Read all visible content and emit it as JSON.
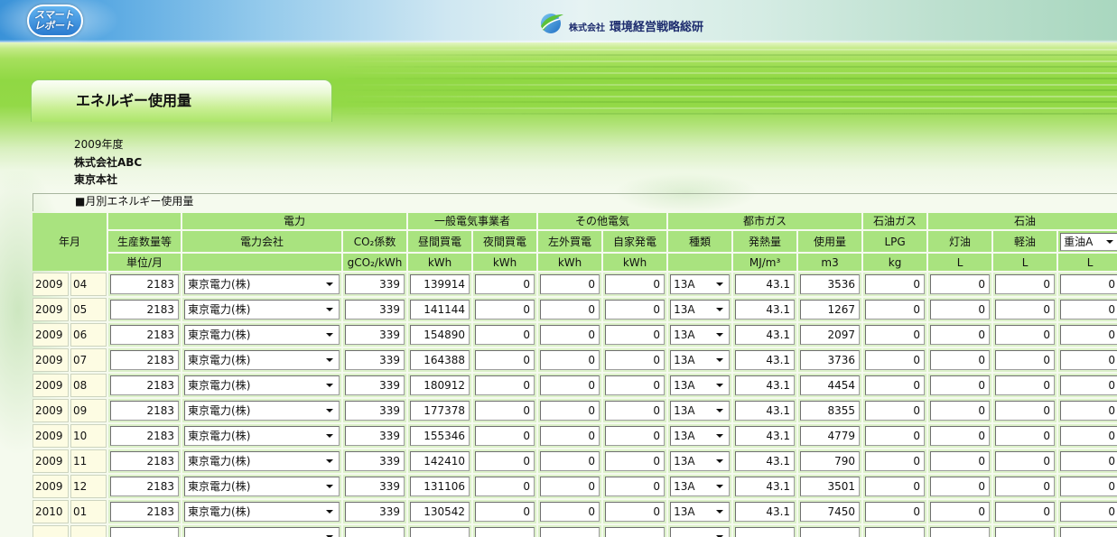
{
  "brand": {
    "logo_line1": "スマート",
    "logo_line2": "レポート",
    "company_prefix": "株式会社",
    "company_name": "環境経営戦略総研"
  },
  "panel": {
    "title": "エネルギー使用量"
  },
  "info": {
    "fiscal_year": "2009年度",
    "company": "株式会社ABC",
    "office": "東京本社"
  },
  "section": {
    "title": "■月別エネルギー使用量"
  },
  "table": {
    "headers": {
      "year_month": "年月",
      "groups": {
        "electricity": "電力",
        "general_utility": "一般電気事業者",
        "other_electricity": "その他電気",
        "city_gas": "都市ガス",
        "lp_gas": "石油ガス",
        "oil": "石油"
      },
      "columns": {
        "production": "生産数量等",
        "power_company": "電力会社",
        "co2_factor": "CO₂係数",
        "day_purchase": "昼間買電",
        "night_purchase": "夜間買電",
        "outside_purchase": "左外買電",
        "self_generation": "自家発電",
        "gas_type": "種類",
        "heat_value": "発熱量",
        "gas_usage": "使用量",
        "lpg": "LPG",
        "kerosene": "灯油",
        "light_oil": "軽油",
        "heavy_oil": "重油A"
      },
      "units": {
        "production": "単位/月",
        "co2_factor": "gCO₂/kWh",
        "day_purchase": "kWh",
        "night_purchase": "kWh",
        "outside_purchase": "kWh",
        "self_generation": "kWh",
        "heat_value": "MJ/m³",
        "gas_usage": "m3",
        "lpg": "kg",
        "kerosene": "L",
        "light_oil": "L",
        "heavy_oil": "L"
      }
    },
    "rows": [
      {
        "year": "2009",
        "month": "04",
        "production": "2183",
        "power_company": "東京電力(株)",
        "co2_factor": "339",
        "day_purchase": "139914",
        "night_purchase": "0",
        "outside_purchase": "0",
        "self_generation": "0",
        "gas_type": "13A",
        "heat_value": "43.1",
        "gas_usage": "3536",
        "lpg": "0",
        "kerosene": "0",
        "light_oil": "0",
        "heavy_oil": "0"
      },
      {
        "year": "2009",
        "month": "05",
        "production": "2183",
        "power_company": "東京電力(株)",
        "co2_factor": "339",
        "day_purchase": "141144",
        "night_purchase": "0",
        "outside_purchase": "0",
        "self_generation": "0",
        "gas_type": "13A",
        "heat_value": "43.1",
        "gas_usage": "1267",
        "lpg": "0",
        "kerosene": "0",
        "light_oil": "0",
        "heavy_oil": "0"
      },
      {
        "year": "2009",
        "month": "06",
        "production": "2183",
        "power_company": "東京電力(株)",
        "co2_factor": "339",
        "day_purchase": "154890",
        "night_purchase": "0",
        "outside_purchase": "0",
        "self_generation": "0",
        "gas_type": "13A",
        "heat_value": "43.1",
        "gas_usage": "2097",
        "lpg": "0",
        "kerosene": "0",
        "light_oil": "0",
        "heavy_oil": "0"
      },
      {
        "year": "2009",
        "month": "07",
        "production": "2183",
        "power_company": "東京電力(株)",
        "co2_factor": "339",
        "day_purchase": "164388",
        "night_purchase": "0",
        "outside_purchase": "0",
        "self_generation": "0",
        "gas_type": "13A",
        "heat_value": "43.1",
        "gas_usage": "3736",
        "lpg": "0",
        "kerosene": "0",
        "light_oil": "0",
        "heavy_oil": "0"
      },
      {
        "year": "2009",
        "month": "08",
        "production": "2183",
        "power_company": "東京電力(株)",
        "co2_factor": "339",
        "day_purchase": "180912",
        "night_purchase": "0",
        "outside_purchase": "0",
        "self_generation": "0",
        "gas_type": "13A",
        "heat_value": "43.1",
        "gas_usage": "4454",
        "lpg": "0",
        "kerosene": "0",
        "light_oil": "0",
        "heavy_oil": "0"
      },
      {
        "year": "2009",
        "month": "09",
        "production": "2183",
        "power_company": "東京電力(株)",
        "co2_factor": "339",
        "day_purchase": "177378",
        "night_purchase": "0",
        "outside_purchase": "0",
        "self_generation": "0",
        "gas_type": "13A",
        "heat_value": "43.1",
        "gas_usage": "8355",
        "lpg": "0",
        "kerosene": "0",
        "light_oil": "0",
        "heavy_oil": "0"
      },
      {
        "year": "2009",
        "month": "10",
        "production": "2183",
        "power_company": "東京電力(株)",
        "co2_factor": "339",
        "day_purchase": "155346",
        "night_purchase": "0",
        "outside_purchase": "0",
        "self_generation": "0",
        "gas_type": "13A",
        "heat_value": "43.1",
        "gas_usage": "4779",
        "lpg": "0",
        "kerosene": "0",
        "light_oil": "0",
        "heavy_oil": "0"
      },
      {
        "year": "2009",
        "month": "11",
        "production": "2183",
        "power_company": "東京電力(株)",
        "co2_factor": "339",
        "day_purchase": "142410",
        "night_purchase": "0",
        "outside_purchase": "0",
        "self_generation": "0",
        "gas_type": "13A",
        "heat_value": "43.1",
        "gas_usage": "790",
        "lpg": "0",
        "kerosene": "0",
        "light_oil": "0",
        "heavy_oil": "0"
      },
      {
        "year": "2009",
        "month": "12",
        "production": "2183",
        "power_company": "東京電力(株)",
        "co2_factor": "339",
        "day_purchase": "131106",
        "night_purchase": "0",
        "outside_purchase": "0",
        "self_generation": "0",
        "gas_type": "13A",
        "heat_value": "43.1",
        "gas_usage": "3501",
        "lpg": "0",
        "kerosene": "0",
        "light_oil": "0",
        "heavy_oil": "0"
      },
      {
        "year": "2010",
        "month": "01",
        "production": "2183",
        "power_company": "東京電力(株)",
        "co2_factor": "339",
        "day_purchase": "130542",
        "night_purchase": "0",
        "outside_purchase": "0",
        "self_generation": "0",
        "gas_type": "13A",
        "heat_value": "43.1",
        "gas_usage": "7450",
        "lpg": "0",
        "kerosene": "0",
        "light_oil": "0",
        "heavy_oil": "0"
      }
    ]
  },
  "icons": {
    "dropdown": "dropdown-arrow-icon",
    "brand": "company-leaf-icon"
  },
  "colors": {
    "header_cell": "#a9e37f",
    "data_cell": "#dcf1c9",
    "year_cell": "#fdfce3",
    "brand_text": "#1d2c6e",
    "logo_blue": "#2a7bd0"
  }
}
